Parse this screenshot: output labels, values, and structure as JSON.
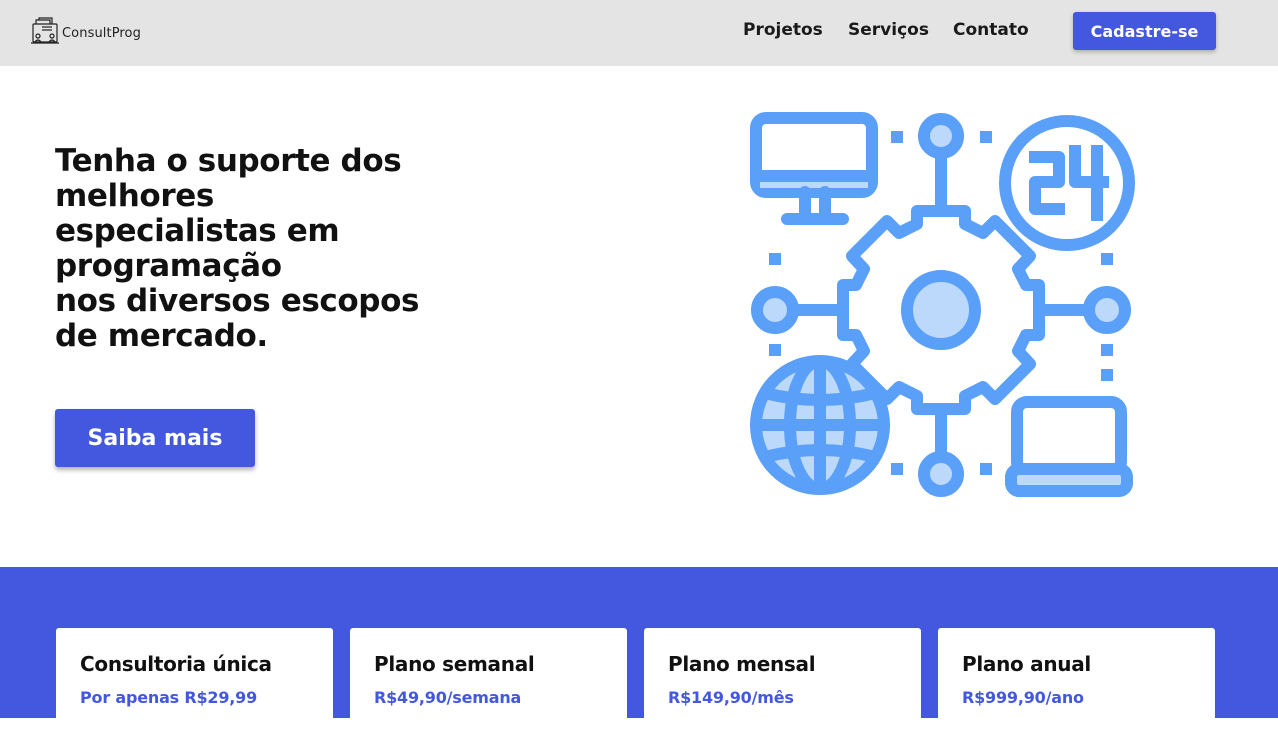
{
  "brand": {
    "name": "ConsultProg",
    "icon": "consulting-book-icon"
  },
  "nav": {
    "links": [
      "Projetos",
      "Serviços",
      "Contato"
    ],
    "signup_label": "Cadastre-se"
  },
  "hero": {
    "title_lines": [
      "Tenha o suporte dos",
      "melhores",
      "especialistas em",
      "programação",
      "nos diversos escopos",
      "de mercado."
    ],
    "cta_label": "Saiba mais",
    "illustration": "tech-network-gear-icon"
  },
  "plans": [
    {
      "title": "Consultoria única",
      "price": "Por apenas R$29,99"
    },
    {
      "title": "Plano semanal",
      "price": "R$49,90/semana"
    },
    {
      "title": "Plano mensal",
      "price": "R$149,90/mês"
    },
    {
      "title": "Plano anual",
      "price": "R$999,90/ano"
    }
  ],
  "colors": {
    "accent": "#4458df",
    "navbar_bg": "#e4e4e4",
    "illustration_dark": "#5aa0f8",
    "illustration_light": "#bcd8fb"
  }
}
